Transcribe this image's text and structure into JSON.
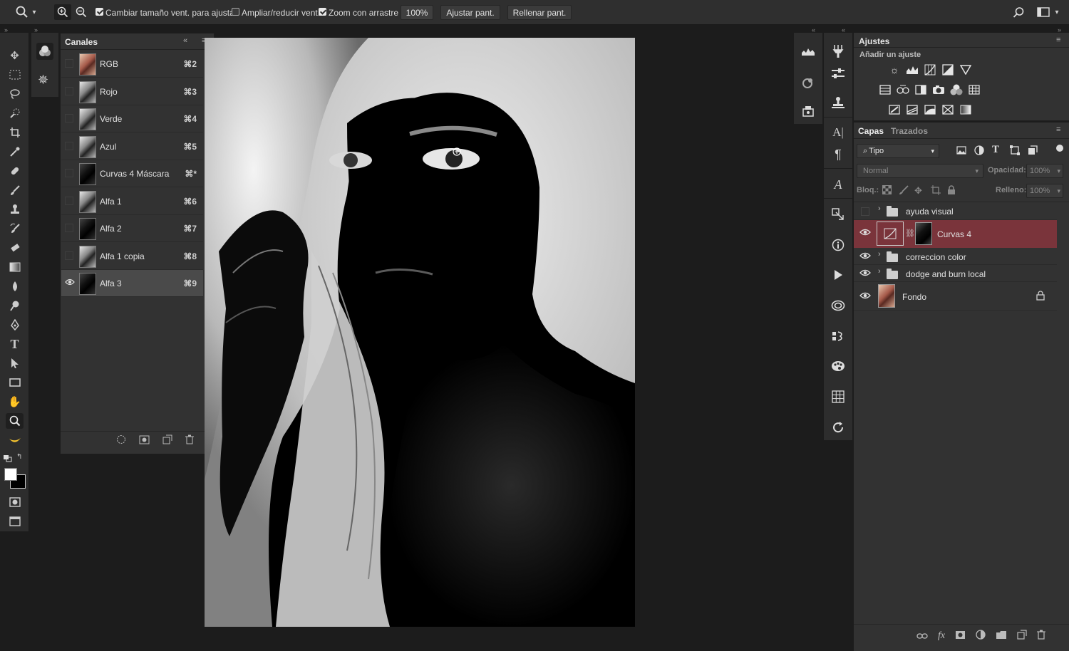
{
  "options_bar": {
    "resize_windows_label": "Cambiar tamaño vent. para ajustar",
    "resize_windows_checked": true,
    "zoom_all_windows_label": "Ampliar/reducir vent.",
    "zoom_all_windows_checked": false,
    "scrubby_zoom_label": "Zoom con arrastre",
    "scrubby_zoom_checked": true,
    "zoom_value": "100%",
    "fit_screen_label": "Ajustar pant.",
    "fill_screen_label": "Rellenar pant."
  },
  "channels_panel": {
    "title": "Canales",
    "channels": [
      {
        "name": "RGB",
        "shortcut": "⌘2",
        "visible": false,
        "thumb": "rgb"
      },
      {
        "name": "Rojo",
        "shortcut": "⌘3",
        "visible": false,
        "thumb": "gray"
      },
      {
        "name": "Verde",
        "shortcut": "⌘4",
        "visible": false,
        "thumb": "gray"
      },
      {
        "name": "Azul",
        "shortcut": "⌘5",
        "visible": false,
        "thumb": "gray"
      },
      {
        "name": "Curvas 4 Máscara",
        "shortcut": "⌘*",
        "visible": false,
        "thumb": "dark"
      },
      {
        "name": "Alfa 1",
        "shortcut": "⌘6",
        "visible": false,
        "thumb": "gray"
      },
      {
        "name": "Alfa 2",
        "shortcut": "⌘7",
        "visible": false,
        "thumb": "dark"
      },
      {
        "name": "Alfa 1 copia",
        "shortcut": "⌘8",
        "visible": false,
        "thumb": "gray"
      },
      {
        "name": "Alfa 3",
        "shortcut": "⌘9",
        "visible": true,
        "thumb": "dark",
        "selected": true
      }
    ]
  },
  "adjustments_panel": {
    "title": "Ajustes",
    "subtitle": "Añadir un ajuste"
  },
  "layers_panel": {
    "tab_layers": "Capas",
    "tab_paths": "Trazados",
    "filter_kind": "Tipo",
    "blend_mode": "Normal",
    "opacity_label": "Opacidad:",
    "opacity_value": "100%",
    "lock_label": "Bloq.:",
    "fill_label": "Relleno:",
    "fill_value": "100%",
    "layers": [
      {
        "name": "ayuda visual",
        "type": "group",
        "visible": false
      },
      {
        "name": "Curvas 4",
        "type": "adjustment",
        "visible": true,
        "selected": true
      },
      {
        "name": "correccion color",
        "type": "group",
        "visible": true
      },
      {
        "name": "dodge and burn local",
        "type": "group",
        "visible": true
      },
      {
        "name": "Fondo",
        "type": "pixel",
        "visible": true,
        "locked": true
      }
    ]
  },
  "colors": {
    "selected_layer": "#7a343b",
    "panel_bg": "#323232",
    "app_bg": "#1c1c1c"
  }
}
